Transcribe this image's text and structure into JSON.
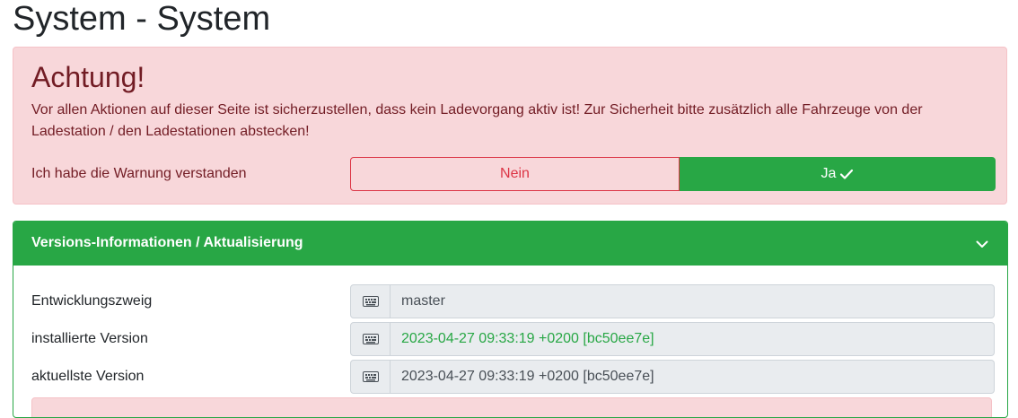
{
  "page": {
    "title": "System - System"
  },
  "warning": {
    "heading": "Achtung!",
    "text": "Vor allen Aktionen auf dieser Seite ist sicherzustellen, dass kein Ladevorgang aktiv ist! Zur Sicherheit bitte zusätzlich alle Fahrzeuge von der Ladestation / den Ladestationen abstecken!",
    "confirm_label": "Ich habe die Warnung verstanden",
    "no_label": "Nein",
    "yes_label": "Ja",
    "yes_selected": true
  },
  "versions": {
    "title": "Versions-Informationen / Aktualisierung",
    "expanded": true,
    "rows": [
      {
        "label": "Entwicklungszweig",
        "value": "master",
        "icon": "keyboard-icon"
      },
      {
        "label": "installierte Version",
        "value": "2023-04-27 09:33:19 +0200 [bc50ee7e]",
        "icon": "keyboard-icon",
        "status": "success"
      },
      {
        "label": "aktuellste Version",
        "value": "2023-04-27 09:33:19 +0200 [bc50ee7e]",
        "icon": "keyboard-icon"
      }
    ]
  },
  "colors": {
    "success": "#28a745",
    "danger": "#dc3545",
    "alert_bg": "#f8d7da",
    "alert_text": "#721c24"
  }
}
